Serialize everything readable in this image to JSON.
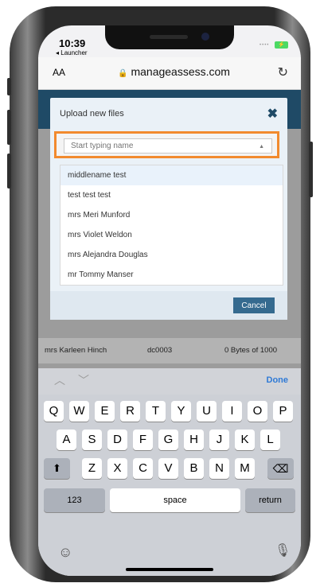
{
  "status": {
    "time": "10:39",
    "back_app": "◂ Launcher",
    "battery_symbol": "⚡"
  },
  "browser": {
    "text_size": "AA",
    "url": "manageassess.com",
    "reload_symbol": "↻"
  },
  "modal": {
    "title": "Upload new files",
    "close_symbol": "✖",
    "search_placeholder": "Start typing name",
    "caret_symbol": "▲",
    "options": [
      "middlename test",
      "test test test",
      "mrs Meri Munford",
      "mrs Violet Weldon",
      "mrs Alejandra Douglas",
      "mr Tommy Manser"
    ],
    "cancel_label": "Cancel"
  },
  "table": {
    "row": {
      "name": "mrs Karleen Hinch",
      "code": "dc0003",
      "size": "0 Bytes of 1000"
    }
  },
  "keyboard": {
    "accessory": {
      "up_symbol": "︿",
      "down_symbol": "﹀",
      "done_label": "Done"
    },
    "row1": [
      "Q",
      "W",
      "E",
      "R",
      "T",
      "Y",
      "U",
      "I",
      "O",
      "P"
    ],
    "row2": [
      "A",
      "S",
      "D",
      "F",
      "G",
      "H",
      "J",
      "K",
      "L"
    ],
    "row3": [
      "Z",
      "X",
      "C",
      "V",
      "B",
      "N",
      "M"
    ],
    "shift_symbol": "⬆",
    "delete_symbol": "⌫",
    "numbers_label": "123",
    "space_label": "space",
    "return_label": "return",
    "emoji_symbol": "☺",
    "mic_symbol": "🎙"
  },
  "colors": {
    "accent_orange": "#f28a2e",
    "header_navy": "#1f4a66",
    "done_blue": "#2f7ad6",
    "cancel_blue": "#356a8f"
  }
}
